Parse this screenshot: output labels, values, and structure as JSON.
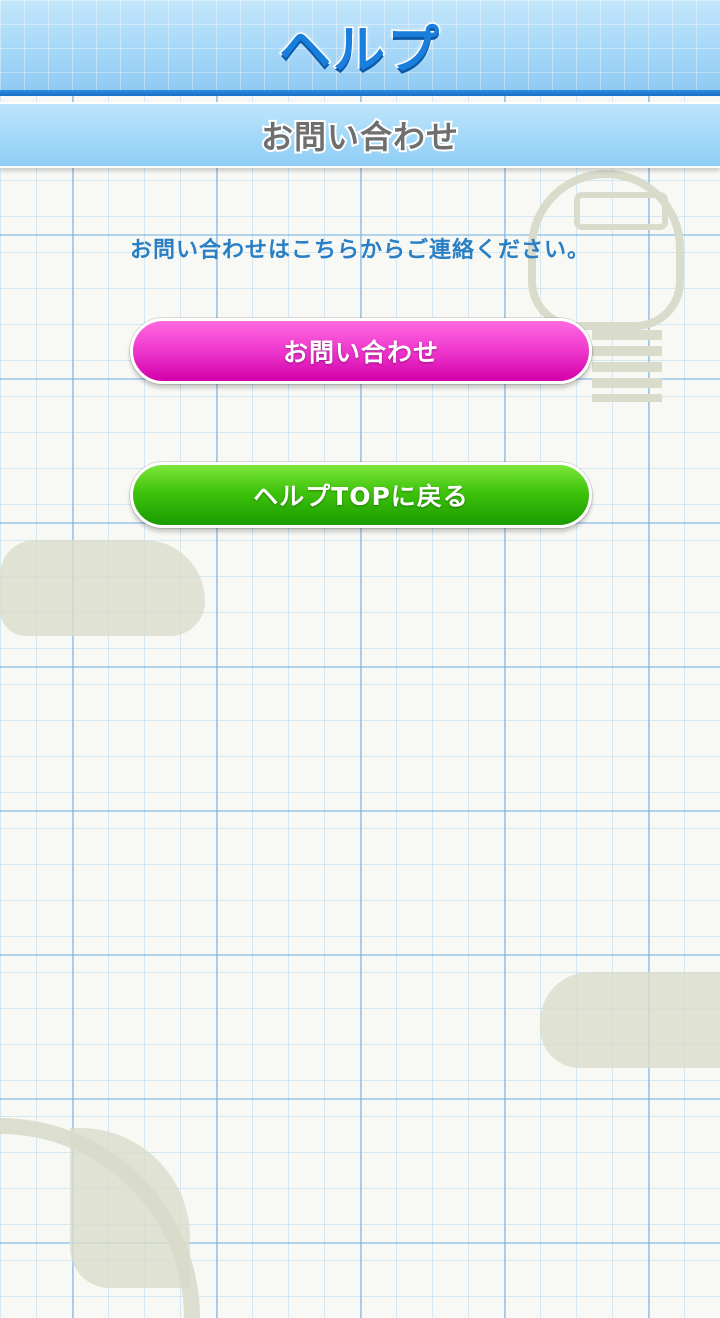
{
  "header": {
    "title": "ヘルプ"
  },
  "subheader": {
    "title": "お問い合わせ"
  },
  "main": {
    "message": "お問い合わせはこちらからご連絡ください。",
    "contact_button_label": "お問い合わせ",
    "help_top_button_label": "ヘルプTOPに戻る"
  },
  "colors": {
    "header_accent": "#1a7fdc",
    "contact_button": "#f03ccf",
    "help_top_button": "#3fc40c",
    "message_text": "#2a7fc4"
  },
  "icons": [
    "lightbulb-decoration",
    "cloud-decoration",
    "leaf-decoration"
  ]
}
